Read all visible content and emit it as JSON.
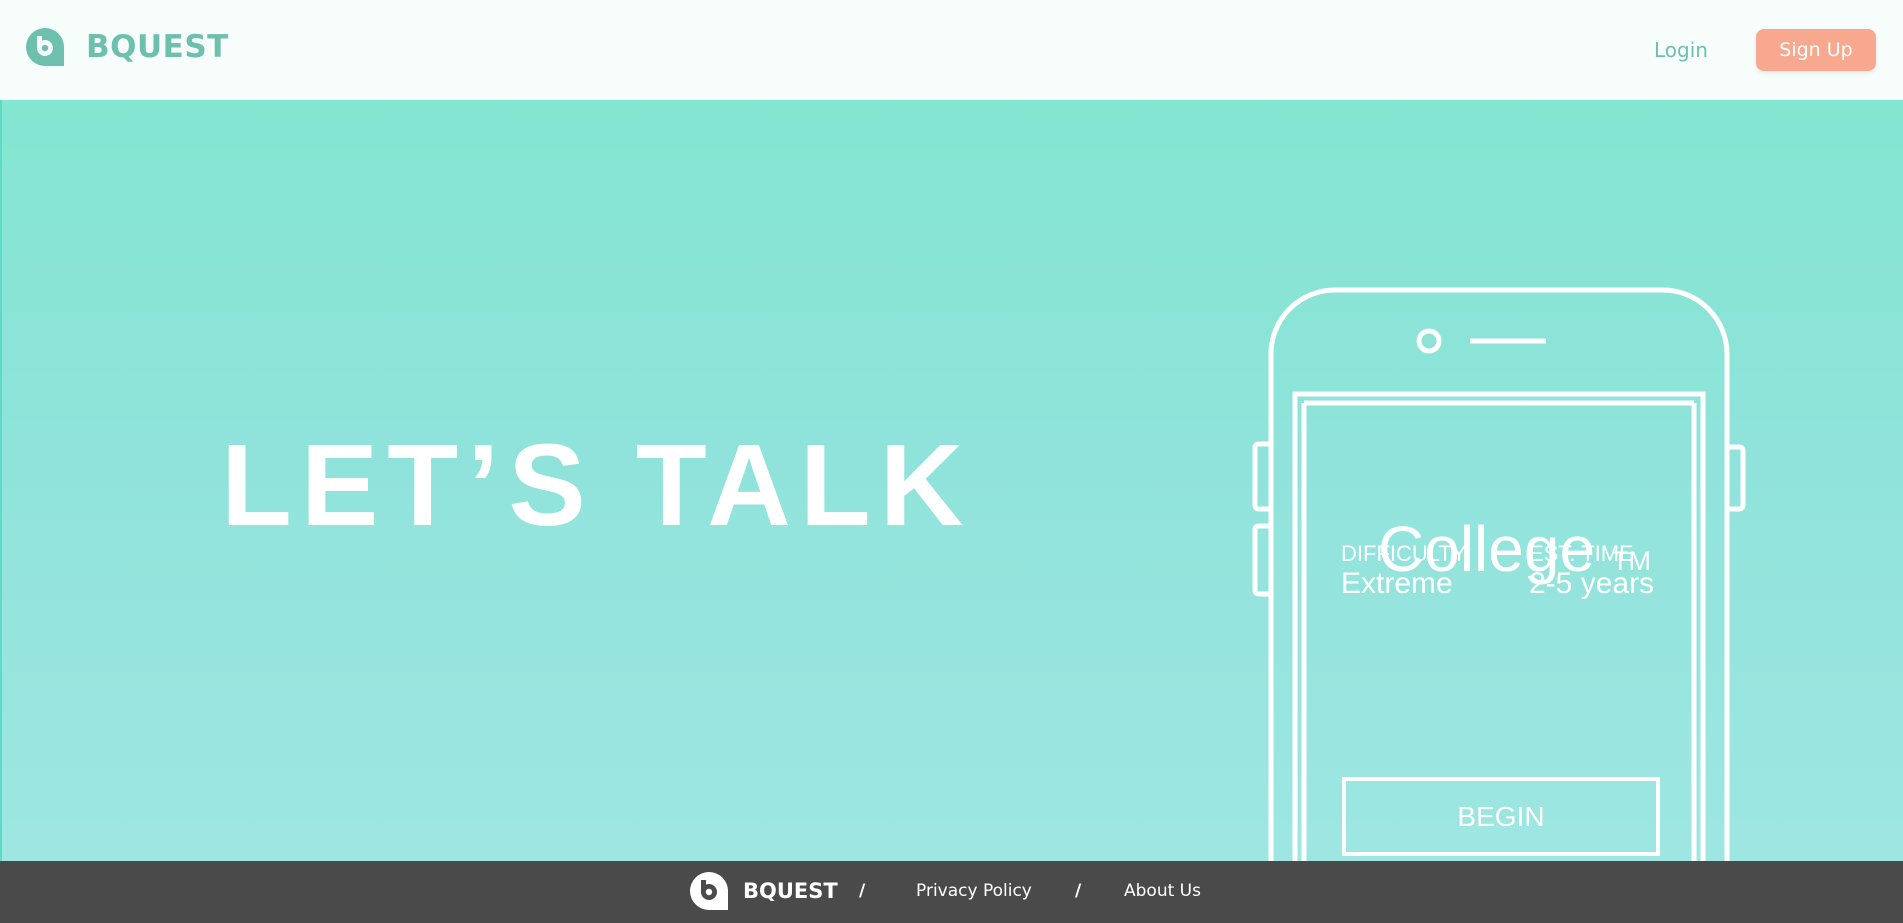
{
  "header": {
    "brand_name": "BQUEST",
    "login_label": "Login",
    "signup_label": "Sign Up"
  },
  "hero": {
    "title": "LET’S TALK",
    "quest_card": {
      "name": "College",
      "trademark": "TM",
      "difficulty_label": "DIFFICULTY",
      "difficulty_value": "Extreme",
      "time_label": "EST. TIME",
      "time_value": "2-5 years",
      "begin_label": "BEGIN"
    }
  },
  "footer": {
    "brand_name": "BQUEST",
    "separator": "/",
    "links": [
      "Privacy Policy",
      "About Us"
    ]
  },
  "icons": {
    "brand_logo": "bquest-logo-icon",
    "phone": "phone-outline-icon"
  },
  "colors": {
    "brand": "#6dbfae",
    "accent": "#f7a88e",
    "hero_top": "#83e6d1",
    "hero_bottom": "#9ee6e2",
    "footer_bg": "#4a4a4a"
  }
}
